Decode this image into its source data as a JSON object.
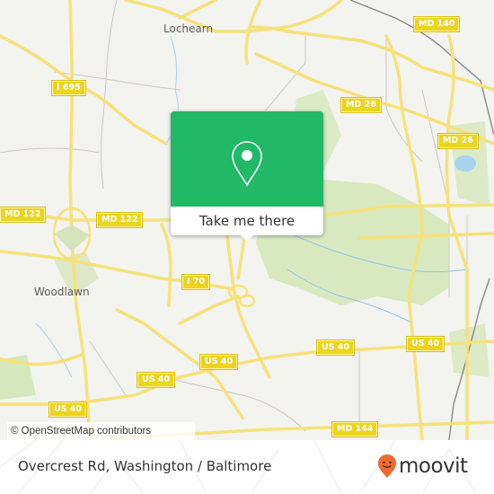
{
  "map": {
    "places": [
      {
        "name": "Lochearn"
      },
      {
        "name": "Woodlawn"
      }
    ],
    "road_shields": [
      {
        "label": "I 695"
      },
      {
        "label": "MD 140"
      },
      {
        "label": "MD 26"
      },
      {
        "label": "MD 26"
      },
      {
        "label": "MD 122"
      },
      {
        "label": "MD 122"
      },
      {
        "label": "I 70"
      },
      {
        "label": "US 40"
      },
      {
        "label": "US 40"
      },
      {
        "label": "US 40"
      },
      {
        "label": "US 40"
      },
      {
        "label": "US 40"
      },
      {
        "label": "MD 144"
      }
    ],
    "attribution": "© OpenStreetMap contributors",
    "colors": {
      "background": "#f3f3ef",
      "road": "#f6e27a",
      "park": "#d8e9c0",
      "water": "#a9d3f0",
      "shield": "#ecd41f"
    }
  },
  "popup": {
    "icon": "map-pin-icon",
    "button_label": "Take me there",
    "color": "#21b866"
  },
  "footer": {
    "location_title": "Overcrest Rd, Washington / Baltimore",
    "brand": "moovit",
    "brand_color": "#f06a30"
  }
}
